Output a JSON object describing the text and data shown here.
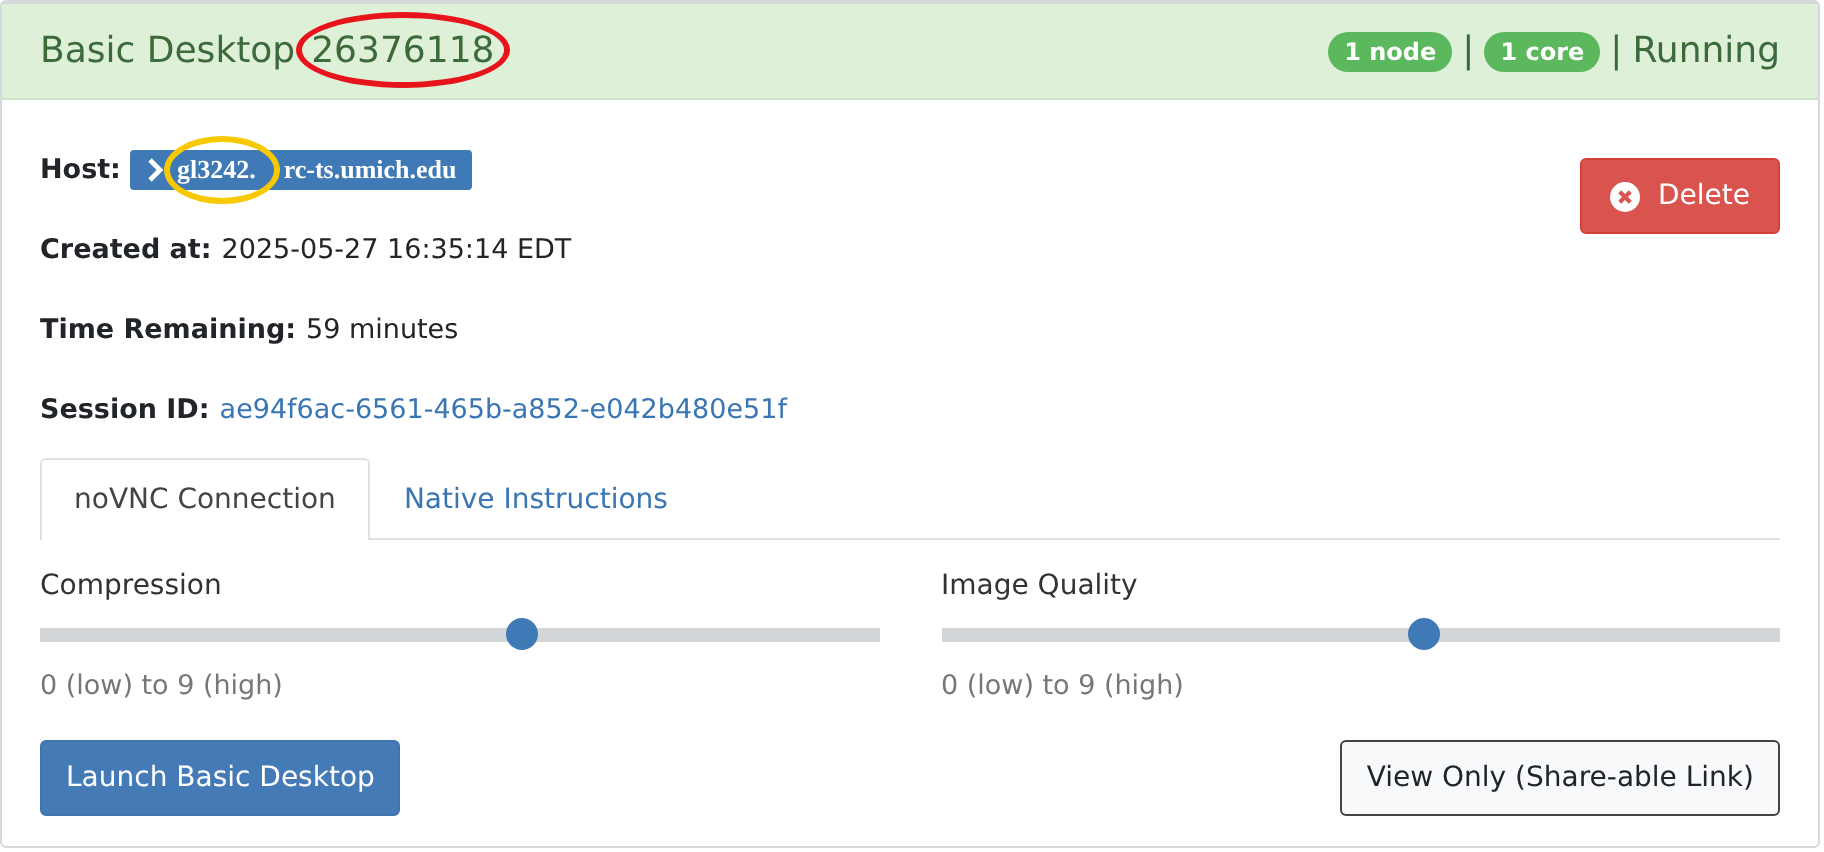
{
  "header": {
    "title": "Basic Desktop",
    "job_id": {
      "text": "26376118",
      "circle": {
        "color": "#e8141c"
      }
    },
    "badges": [
      "1 node",
      "1 core"
    ],
    "separator": "|",
    "status": "Running"
  },
  "host": {
    "label": "Host:",
    "value_parts": [
      "gl3242.",
      "rc-ts.umich.edu"
    ],
    "circle": {
      "color": "#f8c800"
    }
  },
  "delete_button": "Delete",
  "fields": [
    {
      "label": "Created at:",
      "value": "2025-05-27 16:35:14 EDT",
      "kind": "text"
    },
    {
      "label": "Time Remaining:",
      "value": "59 minutes",
      "kind": "text"
    },
    {
      "label": "Session ID:",
      "value": "ae94f6ac-6561-465b-a852-e042b480e51f",
      "kind": "link"
    }
  ],
  "tabs": [
    {
      "label": "noVNC Connection",
      "selected": true
    },
    {
      "label": "Native Instructions",
      "selected": false
    }
  ],
  "sliders": [
    {
      "label": "Compression",
      "level": 0.556,
      "hint": "0 (low) to 9 (high)"
    },
    {
      "label": "Image Quality",
      "level": 0.556,
      "hint": "0 (low) to 9 (high)"
    }
  ],
  "buttons": [
    {
      "label": "Launch Basic Desktop",
      "kind": "primary"
    },
    {
      "label": "View Only (Share-able Link)",
      "kind": "secondary"
    }
  ]
}
